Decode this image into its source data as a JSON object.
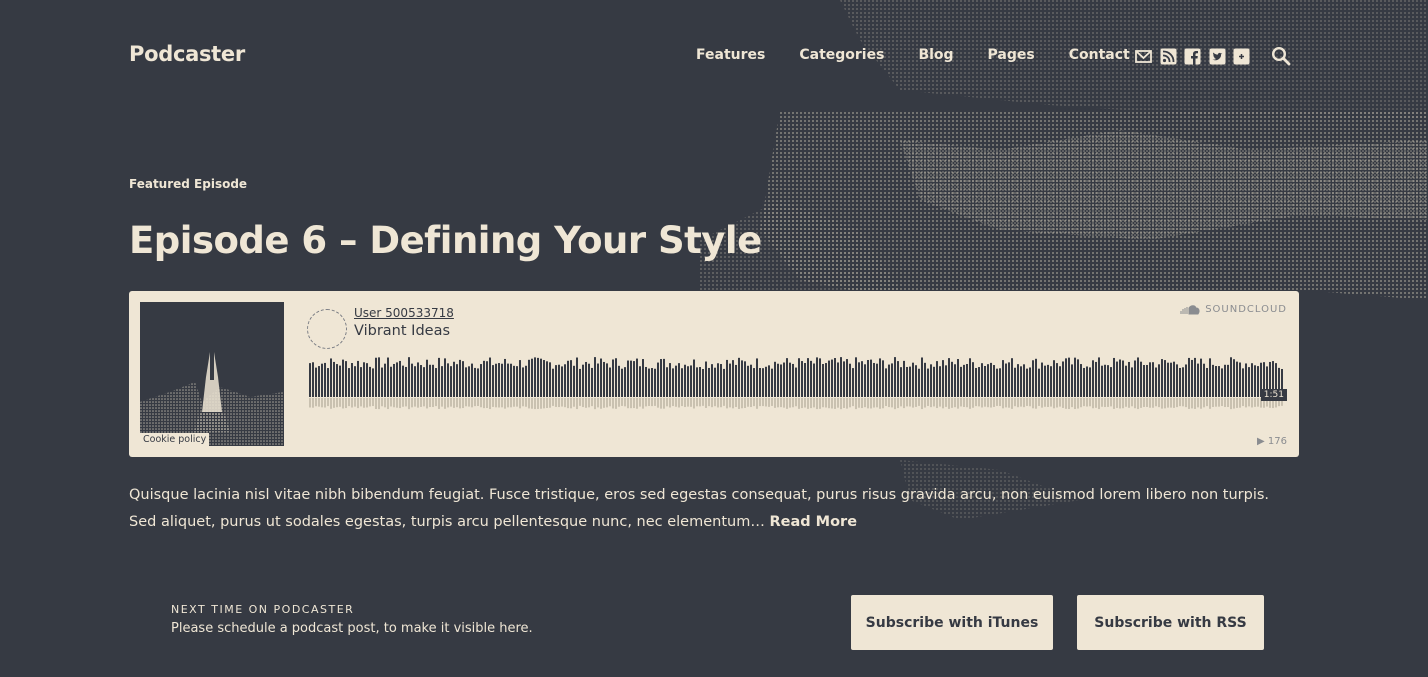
{
  "header": {
    "logo": "Podcaster",
    "nav": [
      "Features",
      "Categories",
      "Blog",
      "Pages",
      "Contact"
    ]
  },
  "social_icons": [
    "mail-icon",
    "rss-icon",
    "facebook-icon",
    "twitter-icon",
    "plus-icon",
    "search-icon"
  ],
  "featured": {
    "kicker": "Featured Episode",
    "title": "Episode 6 – Defining Your Style"
  },
  "player": {
    "user": "User 500533718",
    "track": "Vibrant Ideas",
    "duration": "1:51",
    "plays": "176",
    "cookie_policy": "Cookie policy",
    "brand": "SOUNDCLOUD"
  },
  "excerpt": {
    "text": "Quisque lacinia nisl vitae nibh bibendum feugiat. Fusce tristique, eros sed egestas consequat, purus risus gravida arcu, non euismod lorem libero non turpis. Sed aliquet, purus ut sodales egestas, turpis arcu pellentesque nunc, nec elementum…",
    "read_more": "Read More"
  },
  "footer": {
    "next_label": "NEXT TIME ON PODCASTER",
    "next_text": "Please schedule a podcast post, to make it visible here.",
    "itunes_button": "Subscribe with iTunes",
    "rss_button": "Subscribe with RSS"
  },
  "colors": {
    "background": "#363a43",
    "cream": "#efe6d5"
  }
}
